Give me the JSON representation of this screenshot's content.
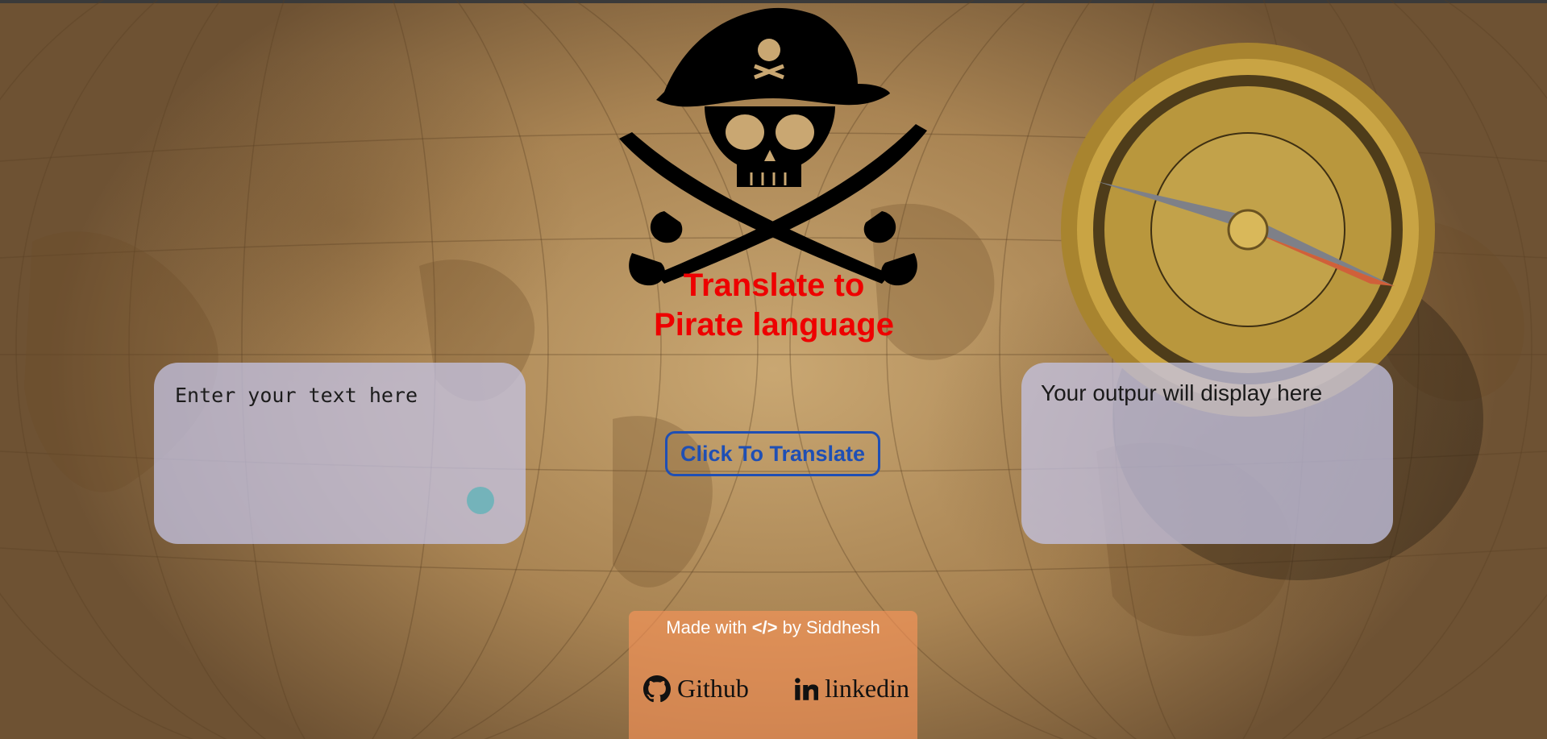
{
  "app": {
    "title_line1": "Translate to",
    "title_line2": "Pirate language"
  },
  "input": {
    "placeholder": "Enter your text here",
    "value": ""
  },
  "output": {
    "text": "Your outpur will display here"
  },
  "translate_button": {
    "label": "Click To Translate"
  },
  "footer": {
    "made_prefix": "Made with",
    "code_symbol": "</>",
    "made_suffix": "by Siddhesh",
    "links": [
      {
        "label": "Github",
        "icon": "github-icon"
      },
      {
        "label": "linkedin",
        "icon": "linkedin-icon"
      }
    ]
  },
  "colors": {
    "title": "#ee0000",
    "button": "#1f4fb4",
    "panel": "#c4c4e6",
    "footer": "#ff965a"
  }
}
